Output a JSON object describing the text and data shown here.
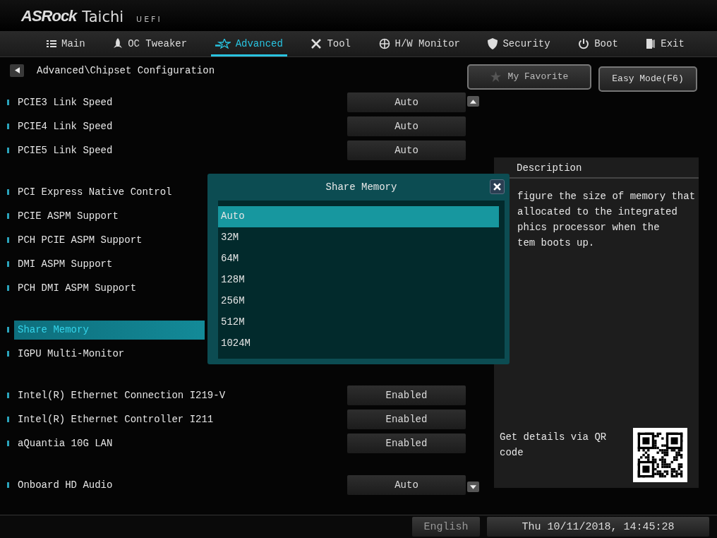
{
  "brand": {
    "logo": "ASRock",
    "model": "Taichi",
    "firmware": "UEFI"
  },
  "tabs": [
    {
      "label": "Main",
      "selected": false
    },
    {
      "label": "OC Tweaker",
      "selected": false
    },
    {
      "label": "Advanced",
      "selected": true
    },
    {
      "label": "Tool",
      "selected": false
    },
    {
      "label": "H/W Monitor",
      "selected": false
    },
    {
      "label": "Security",
      "selected": false
    },
    {
      "label": "Boot",
      "selected": false
    },
    {
      "label": "Exit",
      "selected": false
    }
  ],
  "breadcrumb": "Advanced\\Chipset Configuration",
  "favorite_button": "My Favorite",
  "easy_mode_button": "Easy Mode(F6)",
  "settings": [
    {
      "items": [
        {
          "label": "PCIE3 Link Speed",
          "value": "Auto",
          "selected": false
        },
        {
          "label": "PCIE4 Link Speed",
          "value": "Auto",
          "selected": false
        },
        {
          "label": "PCIE5 Link Speed",
          "value": "Auto",
          "selected": false
        }
      ]
    },
    {
      "items": [
        {
          "label": "PCI Express Native Control",
          "selected": false
        },
        {
          "label": "PCIE ASPM Support",
          "selected": false
        },
        {
          "label": "PCH PCIE ASPM Support",
          "selected": false
        },
        {
          "label": "DMI ASPM Support",
          "selected": false
        },
        {
          "label": "PCH DMI ASPM Support",
          "selected": false
        }
      ]
    },
    {
      "items": [
        {
          "label": "Share Memory",
          "selected": true
        },
        {
          "label": "IGPU Multi-Monitor",
          "selected": false
        }
      ]
    },
    {
      "items": [
        {
          "label": "Intel(R) Ethernet Connection I219-V",
          "value": "Enabled",
          "selected": false
        },
        {
          "label": "Intel(R) Ethernet Controller I211",
          "value": "Enabled",
          "selected": false
        },
        {
          "label": "aQuantia 10G LAN",
          "value": "Enabled",
          "selected": false
        }
      ]
    },
    {
      "items": [
        {
          "label": "Onboard HD Audio",
          "value": "Auto",
          "selected": false
        }
      ]
    }
  ],
  "description": {
    "title": "Description",
    "lines": [
      "figure the size of memory that",
      "allocated to the integrated",
      "phics processor when the",
      "tem boots up."
    ]
  },
  "qr": {
    "text": "Get details via QR code"
  },
  "dialog": {
    "title": "Share Memory",
    "options": [
      {
        "label": "Auto",
        "selected": true
      },
      {
        "label": "32M",
        "selected": false
      },
      {
        "label": "64M",
        "selected": false
      },
      {
        "label": "128M",
        "selected": false
      },
      {
        "label": "256M",
        "selected": false
      },
      {
        "label": "512M",
        "selected": false
      },
      {
        "label": "1024M",
        "selected": false
      }
    ]
  },
  "footer": {
    "language": "English",
    "datetime": "Thu 10/11/2018, 14:45:28"
  }
}
